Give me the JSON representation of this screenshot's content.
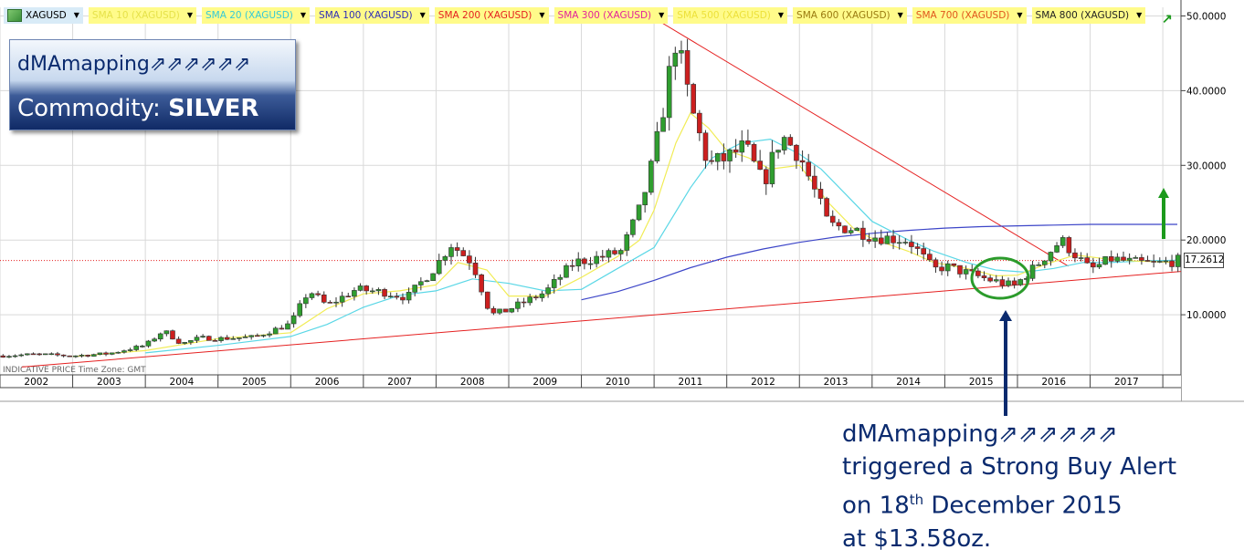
{
  "toolbar": [
    {
      "label": "XAGUSD",
      "color": "#000000",
      "bg": "blue",
      "icon": true
    },
    {
      "label": "SMA 10 (XAGUSD)",
      "color": "#e6e24a",
      "bg": "yellow"
    },
    {
      "label": "SMA 20 (XAGUSD)",
      "color": "#35c9d6",
      "bg": "yellow"
    },
    {
      "label": "SMA 100 (XAGUSD)",
      "color": "#2d2db8",
      "bg": "yellow"
    },
    {
      "label": "SMA 200 (XAGUSD)",
      "color": "#e52020",
      "bg": "yellow"
    },
    {
      "label": "SMA 300 (XAGUSD)",
      "color": "#e2239a",
      "bg": "yellow"
    },
    {
      "label": "SMA 500 (XAGUSD)",
      "color": "#ede13a",
      "bg": "yellow"
    },
    {
      "label": "SMA 600 (XAGUSD)",
      "color": "#9a7a10",
      "bg": "yellow"
    },
    {
      "label": "SMA 700 (XAGUSD)",
      "color": "#e0561c",
      "bg": "yellow"
    },
    {
      "label": "SMA 800 (XAGUSD)",
      "color": "#222222",
      "bg": "yellow"
    }
  ],
  "title_box": {
    "brand": "dMAmapping⇗⇗⇗⇗⇗⇗",
    "commodity_label": "Commodity: ",
    "commodity_value": "SILVER"
  },
  "annotation": {
    "line1": "dMAmapping⇗⇗⇗⇗⇗⇗",
    "line2": "triggered a Strong Buy Alert",
    "line3_pre": "on 18",
    "line3_sup": "th",
    "line3_post": " December 2015",
    "line4": "at $13.58oz."
  },
  "chart_info": {
    "indicative": "INDICATIVE PRICE",
    "timezone": "Time Zone: GMT",
    "last_price": "17.2612"
  },
  "colors": {
    "up": "#2f9e2f",
    "down": "#cc1f1f",
    "sma10": "#f1ec55",
    "sma20": "#5ad7e6",
    "sma100": "#3c45c8",
    "trend": "#e52020",
    "circle": "#2b9b2b",
    "arrow_green": "#1c9a1c",
    "arrow_navy": "#0a2a6e"
  },
  "chart_data": {
    "type": "candlestick",
    "symbol": "XAGUSD",
    "x_labels": [
      "2002",
      "2003",
      "2004",
      "2005",
      "2006",
      "2007",
      "2008",
      "2009",
      "2010",
      "2011",
      "2012",
      "2013",
      "2014",
      "2015",
      "2016",
      "2017"
    ],
    "y_ticks": [
      "10.0000",
      "20.0000",
      "30.0000",
      "40.0000",
      "50.0000"
    ],
    "ylim": [
      0,
      51.5
    ],
    "x_range": [
      2002.0,
      2018.25
    ],
    "grid": true,
    "last_price": 17.2612,
    "anchors": [
      [
        2002.0,
        4.5
      ],
      [
        2002.5,
        4.7
      ],
      [
        2003.0,
        4.5
      ],
      [
        2003.5,
        4.8
      ],
      [
        2004.0,
        5.9
      ],
      [
        2004.25,
        7.9
      ],
      [
        2004.5,
        6.1
      ],
      [
        2004.75,
        6.9
      ],
      [
        2005.0,
        6.8
      ],
      [
        2005.5,
        7.0
      ],
      [
        2006.0,
        8.8
      ],
      [
        2006.25,
        13.3
      ],
      [
        2006.5,
        11.2
      ],
      [
        2006.9,
        13.4
      ],
      [
        2007.3,
        13.0
      ],
      [
        2007.6,
        12.3
      ],
      [
        2008.0,
        16.5
      ],
      [
        2008.2,
        19.5
      ],
      [
        2008.5,
        17.0
      ],
      [
        2008.75,
        10.0
      ],
      [
        2008.95,
        10.5
      ],
      [
        2009.5,
        13.0
      ],
      [
        2009.9,
        17.0
      ],
      [
        2010.3,
        17.8
      ],
      [
        2010.55,
        18.5
      ],
      [
        2010.8,
        24.0
      ],
      [
        2011.0,
        31.0
      ],
      [
        2011.3,
        47.0
      ],
      [
        2011.5,
        38.0
      ],
      [
        2011.75,
        30.0
      ],
      [
        2012.0,
        31.0
      ],
      [
        2012.25,
        32.5
      ],
      [
        2012.5,
        27.5
      ],
      [
        2012.75,
        34.0
      ],
      [
        2013.0,
        31.5
      ],
      [
        2013.4,
        22.0
      ],
      [
        2013.75,
        21.5
      ],
      [
        2014.0,
        20.5
      ],
      [
        2014.5,
        20.0
      ],
      [
        2014.85,
        16.0
      ],
      [
        2015.0,
        16.5
      ],
      [
        2015.5,
        15.0
      ],
      [
        2015.95,
        13.8
      ],
      [
        2016.25,
        16.5
      ],
      [
        2016.6,
        20.0
      ],
      [
        2016.8,
        18.0
      ],
      [
        2017.0,
        16.0
      ],
      [
        2017.3,
        17.5
      ],
      [
        2017.6,
        17.0
      ],
      [
        2017.9,
        16.8
      ],
      [
        2018.2,
        17.26
      ]
    ],
    "sma10_points": [
      [
        2003.0,
        4.4
      ],
      [
        2004.0,
        5.2
      ],
      [
        2005.0,
        6.8
      ],
      [
        2006.0,
        7.6
      ],
      [
        2006.5,
        10.8
      ],
      [
        2007.0,
        12.8
      ],
      [
        2007.5,
        13.2
      ],
      [
        2008.0,
        14.0
      ],
      [
        2008.3,
        17.0
      ],
      [
        2008.7,
        16.0
      ],
      [
        2009.0,
        12.5
      ],
      [
        2009.5,
        12.5
      ],
      [
        2010.0,
        15.0
      ],
      [
        2010.5,
        17.8
      ],
      [
        2010.8,
        20.0
      ],
      [
        2011.0,
        24.0
      ],
      [
        2011.3,
        33.0
      ],
      [
        2011.5,
        37.0
      ],
      [
        2011.75,
        35.0
      ],
      [
        2012.0,
        32.0
      ],
      [
        2012.3,
        31.0
      ],
      [
        2012.6,
        29.5
      ],
      [
        2013.0,
        30.0
      ],
      [
        2013.4,
        25.0
      ],
      [
        2013.75,
        21.5
      ],
      [
        2014.0,
        20.2
      ],
      [
        2014.5,
        18.5
      ],
      [
        2014.85,
        17.0
      ],
      [
        2015.3,
        16.2
      ],
      [
        2015.7,
        15.2
      ],
      [
        2016.0,
        15.3
      ],
      [
        2016.4,
        16.8
      ],
      [
        2016.8,
        18.0
      ],
      [
        2017.2,
        17.5
      ],
      [
        2017.6,
        17.2
      ],
      [
        2018.2,
        17.0
      ]
    ],
    "sma20_points": [
      [
        2004.0,
        4.9
      ],
      [
        2005.0,
        5.9
      ],
      [
        2006.0,
        7.1
      ],
      [
        2006.5,
        8.7
      ],
      [
        2007.0,
        11.0
      ],
      [
        2007.5,
        12.6
      ],
      [
        2008.0,
        13.2
      ],
      [
        2008.5,
        14.8
      ],
      [
        2009.0,
        14.2
      ],
      [
        2009.5,
        13.2
      ],
      [
        2010.0,
        13.4
      ],
      [
        2010.5,
        16.2
      ],
      [
        2011.0,
        19.0
      ],
      [
        2011.5,
        27.0
      ],
      [
        2011.8,
        31.0
      ],
      [
        2012.2,
        33.0
      ],
      [
        2012.6,
        33.5
      ],
      [
        2013.0,
        31.5
      ],
      [
        2013.3,
        29.5
      ],
      [
        2013.7,
        25.5
      ],
      [
        2014.0,
        22.5
      ],
      [
        2014.5,
        20.0
      ],
      [
        2014.85,
        18.5
      ],
      [
        2015.3,
        17.0
      ],
      [
        2015.7,
        16.0
      ],
      [
        2016.1,
        15.7
      ],
      [
        2016.5,
        16.2
      ],
      [
        2016.9,
        17.0
      ],
      [
        2017.3,
        17.0
      ],
      [
        2017.7,
        17.2
      ],
      [
        2018.2,
        17.3
      ]
    ],
    "sma100_points": [
      [
        2010.0,
        0.2
      ],
      [
        2010.5,
        1.3
      ],
      [
        2011.0,
        2.8
      ],
      [
        2011.5,
        4.5
      ],
      [
        2012.0,
        5.9
      ],
      [
        2012.5,
        7.0
      ],
      [
        2013.0,
        7.9
      ],
      [
        2013.5,
        8.6
      ],
      [
        2014.0,
        9.1
      ],
      [
        2014.5,
        9.5
      ],
      [
        2015.0,
        9.8
      ],
      [
        2015.5,
        10.0
      ],
      [
        2016.0,
        10.1
      ],
      [
        2016.5,
        10.2
      ],
      [
        2017.0,
        10.3
      ],
      [
        2017.5,
        10.3
      ],
      [
        2018.2,
        10.3
      ]
    ],
    "sma100_offset": 11.8,
    "trend_lines": [
      {
        "from": [
          2002.3,
          3.0
        ],
        "to": [
          2018.25,
          15.8
        ]
      },
      {
        "from": [
          2010.95,
          50.0
        ],
        "to": [
          2016.7,
          16.5
        ]
      }
    ],
    "alert": {
      "date": "18 December 2015",
      "price": 13.58
    }
  }
}
